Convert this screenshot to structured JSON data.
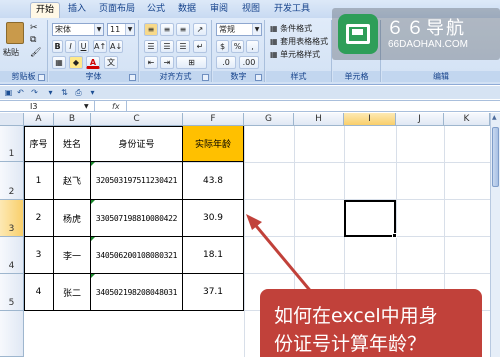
{
  "ribbon": {
    "tabs": [
      "开始",
      "插入",
      "页面布局",
      "公式",
      "数据",
      "审阅",
      "视图",
      "开发工具"
    ],
    "active_tab": "开始",
    "font_name": "宋体",
    "font_size": "11",
    "number_format": "常规",
    "percent": "%",
    "comma": ",",
    "bold": "B",
    "italic": "I",
    "underline": "U",
    "font_color": "A",
    "style_items": [
      "条件格式",
      "套用表格格式",
      "单元格样式"
    ],
    "groups": [
      "剪贴板",
      "字体",
      "对齐方式",
      "数字",
      "样式",
      "单元格",
      "编辑"
    ],
    "paste_label": "粘贴"
  },
  "watermark": {
    "main": "６６导航",
    "sub": "66DAOHAN.COM"
  },
  "formula_bar": {
    "name_box": "I3",
    "fx": "fx"
  },
  "columns": [
    "A",
    "B",
    "C",
    "D",
    "E",
    "F",
    "G",
    "H",
    "I",
    "J",
    "K"
  ],
  "rows": [
    "1",
    "2",
    "3",
    "4",
    "5"
  ],
  "table": {
    "headers": [
      "序号",
      "姓名",
      "身份证号",
      "实际年龄"
    ],
    "rows": [
      {
        "no": "1",
        "name": "赵飞",
        "id": "320503197511230421",
        "age": "43.8"
      },
      {
        "no": "2",
        "name": "杨虎",
        "id": "330507198810080422",
        "age": "30.9"
      },
      {
        "no": "3",
        "name": "李一",
        "id": "340506200108080321",
        "age": "18.1"
      },
      {
        "no": "4",
        "name": "张二",
        "id": "340502198208048031",
        "age": "37.1"
      }
    ]
  },
  "callout": {
    "line1": "如何在excel中用身",
    "line2": "份证号计算年龄？"
  },
  "colors": {
    "header_fill": "#ffc000",
    "callout_fill": "#c1413a",
    "arrow": "#c1413a"
  }
}
